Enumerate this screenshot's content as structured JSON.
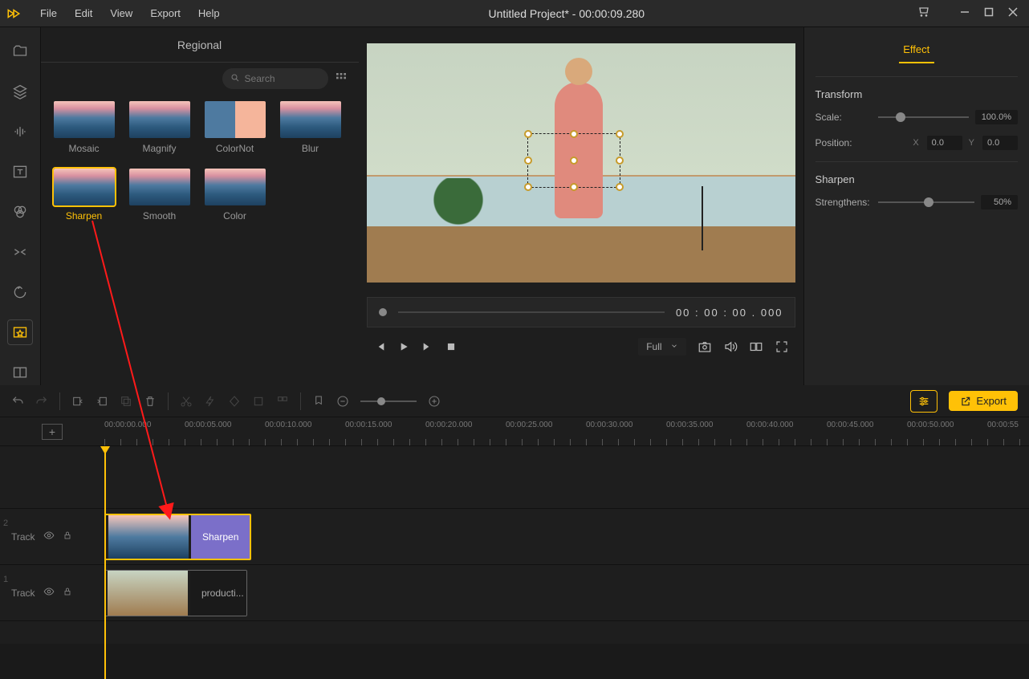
{
  "app": {
    "title": "Untitled Project* - 00:00:09.280",
    "menu": [
      "File",
      "Edit",
      "View",
      "Export",
      "Help"
    ]
  },
  "effectsPanel": {
    "header": "Regional",
    "searchPlaceholder": "Search",
    "items": [
      {
        "label": "Mosaic"
      },
      {
        "label": "Magnify"
      },
      {
        "label": "ColorNot"
      },
      {
        "label": "Blur"
      },
      {
        "label": "Sharpen",
        "selected": true
      },
      {
        "label": "Smooth"
      },
      {
        "label": "Color"
      }
    ]
  },
  "preview": {
    "scrubberTime": "00 : 00 : 00 . 000",
    "sizeSelect": "Full"
  },
  "rightPanel": {
    "tab": "Effect",
    "transform": {
      "title": "Transform",
      "scaleLabel": "Scale:",
      "scaleValue": "100.0%",
      "positionLabel": "Position:",
      "xLabel": "X",
      "xValue": "0.0",
      "yLabel": "Y",
      "yValue": "0.0"
    },
    "sharpen": {
      "title": "Sharpen",
      "strengthLabel": "Strengthens:",
      "strengthValue": "50%"
    }
  },
  "timeline": {
    "exportLabel": "Export",
    "ticks": [
      "00:00:00.000",
      "00:00:05.000",
      "00:00:10.000",
      "00:00:15.000",
      "00:00:20.000",
      "00:00:25.000",
      "00:00:30.000",
      "00:00:35.000",
      "00:00:40.000",
      "00:00:45.000",
      "00:00:50.000",
      "00:00:55"
    ],
    "track2": {
      "num": "2",
      "label": "Track",
      "clipLabel": "Sharpen"
    },
    "track1": {
      "num": "1",
      "label": "Track",
      "clipLabel": "producti..."
    }
  }
}
